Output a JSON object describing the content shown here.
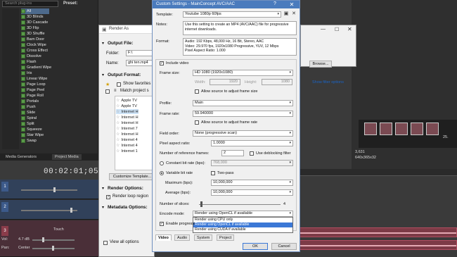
{
  "vegas": {
    "search_placeholder": "Search plug-ins",
    "preview_label": "Preset:",
    "fx_items": [
      "All",
      "3D Blinds",
      "3D Cascade",
      "3D Flip",
      "3D Shuffle",
      "Barn Door",
      "Clock Wipe",
      "Cross Effect",
      "Dissolve",
      "Flash",
      "Gradient Wipe",
      "Iris",
      "Linear Wipe",
      "Page Loop",
      "Page Peel",
      "Page Roll",
      "Portals",
      "Push",
      "Slide",
      "Spiral",
      "Split",
      "Squeeze",
      "Star Wipe",
      "Swap"
    ],
    "tabs": [
      "Media Generators",
      "Project Media"
    ],
    "timecode": "00:02:01;05",
    "right_info": [
      "3,631",
      "640x365x32"
    ],
    "tick_label": "25.",
    "audio_vol_label": "Vol:",
    "audio_vol_value": "4.7 dB",
    "audio_pan_label": "Pan:",
    "audio_pan_value": "Center",
    "touch_label": "Touch",
    "track_numbers": [
      "1",
      "2",
      "3"
    ]
  },
  "render_as": {
    "title": "Render As",
    "output_file_label": "Output File:",
    "folder_label": "Folder:",
    "folder_value": "F:\\",
    "name_label": "Name:",
    "name_value": "ghi ten.mp4",
    "output_format_label": "Output Format:",
    "show_favorites_label": "Show favorites",
    "match_project_label": "Match project s",
    "tree_items": [
      "Apple TV",
      "Apple TV",
      "Internet H",
      "Internet H",
      "Internet H",
      "Internet 7",
      "Internet H",
      "Internet 4",
      "Internet 4",
      "Internet 1"
    ],
    "customize_button": "Customize Template...",
    "render_options_label": "Render Options:",
    "render_loop_label": "Render loop region",
    "metadata_options_label": "Metadata Options:",
    "view_all_label": "View all options",
    "browse_button": "Browse...",
    "filter_link": "Show filter options"
  },
  "custom_settings": {
    "title": "Custom Settings - MainConcept AVC/AAC",
    "help_glyph": "?",
    "close_glyph": "✕",
    "template_label": "Template:",
    "template_value": "Youtube 1080p 60fps",
    "notes_label": "Notes:",
    "notes_value": "Use this setting to create an MP4 (AVC/AAC) file for progressive internet downloads.",
    "format_label": "Format:",
    "format_lines": [
      "Audio: 192 Kbps, 48,000 Hz, 16 Bit, Stereo, AAC",
      "Video: 29.970 fps, 1920x1080 Progressive, YUV, 12 Mbps",
      "Pixel Aspect Ratio: 1.000"
    ],
    "include_video_label": "Include video",
    "frame_size_label": "Frame size:",
    "frame_size_value": "HD 1080 (1920x1080)",
    "width_label": "Width:",
    "width_value": "1920",
    "height_label": "Height:",
    "height_value": "1080",
    "adjust_frame_size_label": "Allow source to adjust frame size",
    "profile_label": "Profile:",
    "profile_value": "Main",
    "frame_rate_label": "Frame rate:",
    "frame_rate_value": "59.940000",
    "adjust_frame_rate_label": "Allow source to adjust frame rate",
    "field_order_label": "Field order:",
    "field_order_value": "None (progressive scan)",
    "pixel_aspect_label": "Pixel aspect ratio:",
    "pixel_aspect_value": "1.0000",
    "ref_frames_label": "Number of reference frames:",
    "ref_frames_value": "2",
    "deblocking_label": "Use deblocking filter",
    "constant_bitrate_label": "Constant bit rate (bps):",
    "constant_bitrate_value": "768,000",
    "variable_bitrate_label": "Variable bit rate",
    "two_pass_label": "Two-pass",
    "maximum_label": "Maximum (bps):",
    "maximum_value": "10,000,000",
    "average_label": "Average (bps):",
    "average_value": "10,000,000",
    "slices_label": "Number of slices:",
    "slices_value": "4",
    "encode_mode_label": "Encode mode:",
    "encode_mode_value": "Render using OpenCL if available",
    "encode_options": [
      "Render using CPU only",
      "Render using OpenCL if available",
      "Render using CUDA if available"
    ],
    "enable_progressive_label": "Enable progressi",
    "tabs": [
      "Video",
      "Audio",
      "System",
      "Project"
    ],
    "ok_button": "OK",
    "cancel_button": "Cancel"
  },
  "colors": {
    "title_bar": "#4a7bbd",
    "selection": "#3b78d6",
    "audio_clip": "#7c3a46"
  }
}
